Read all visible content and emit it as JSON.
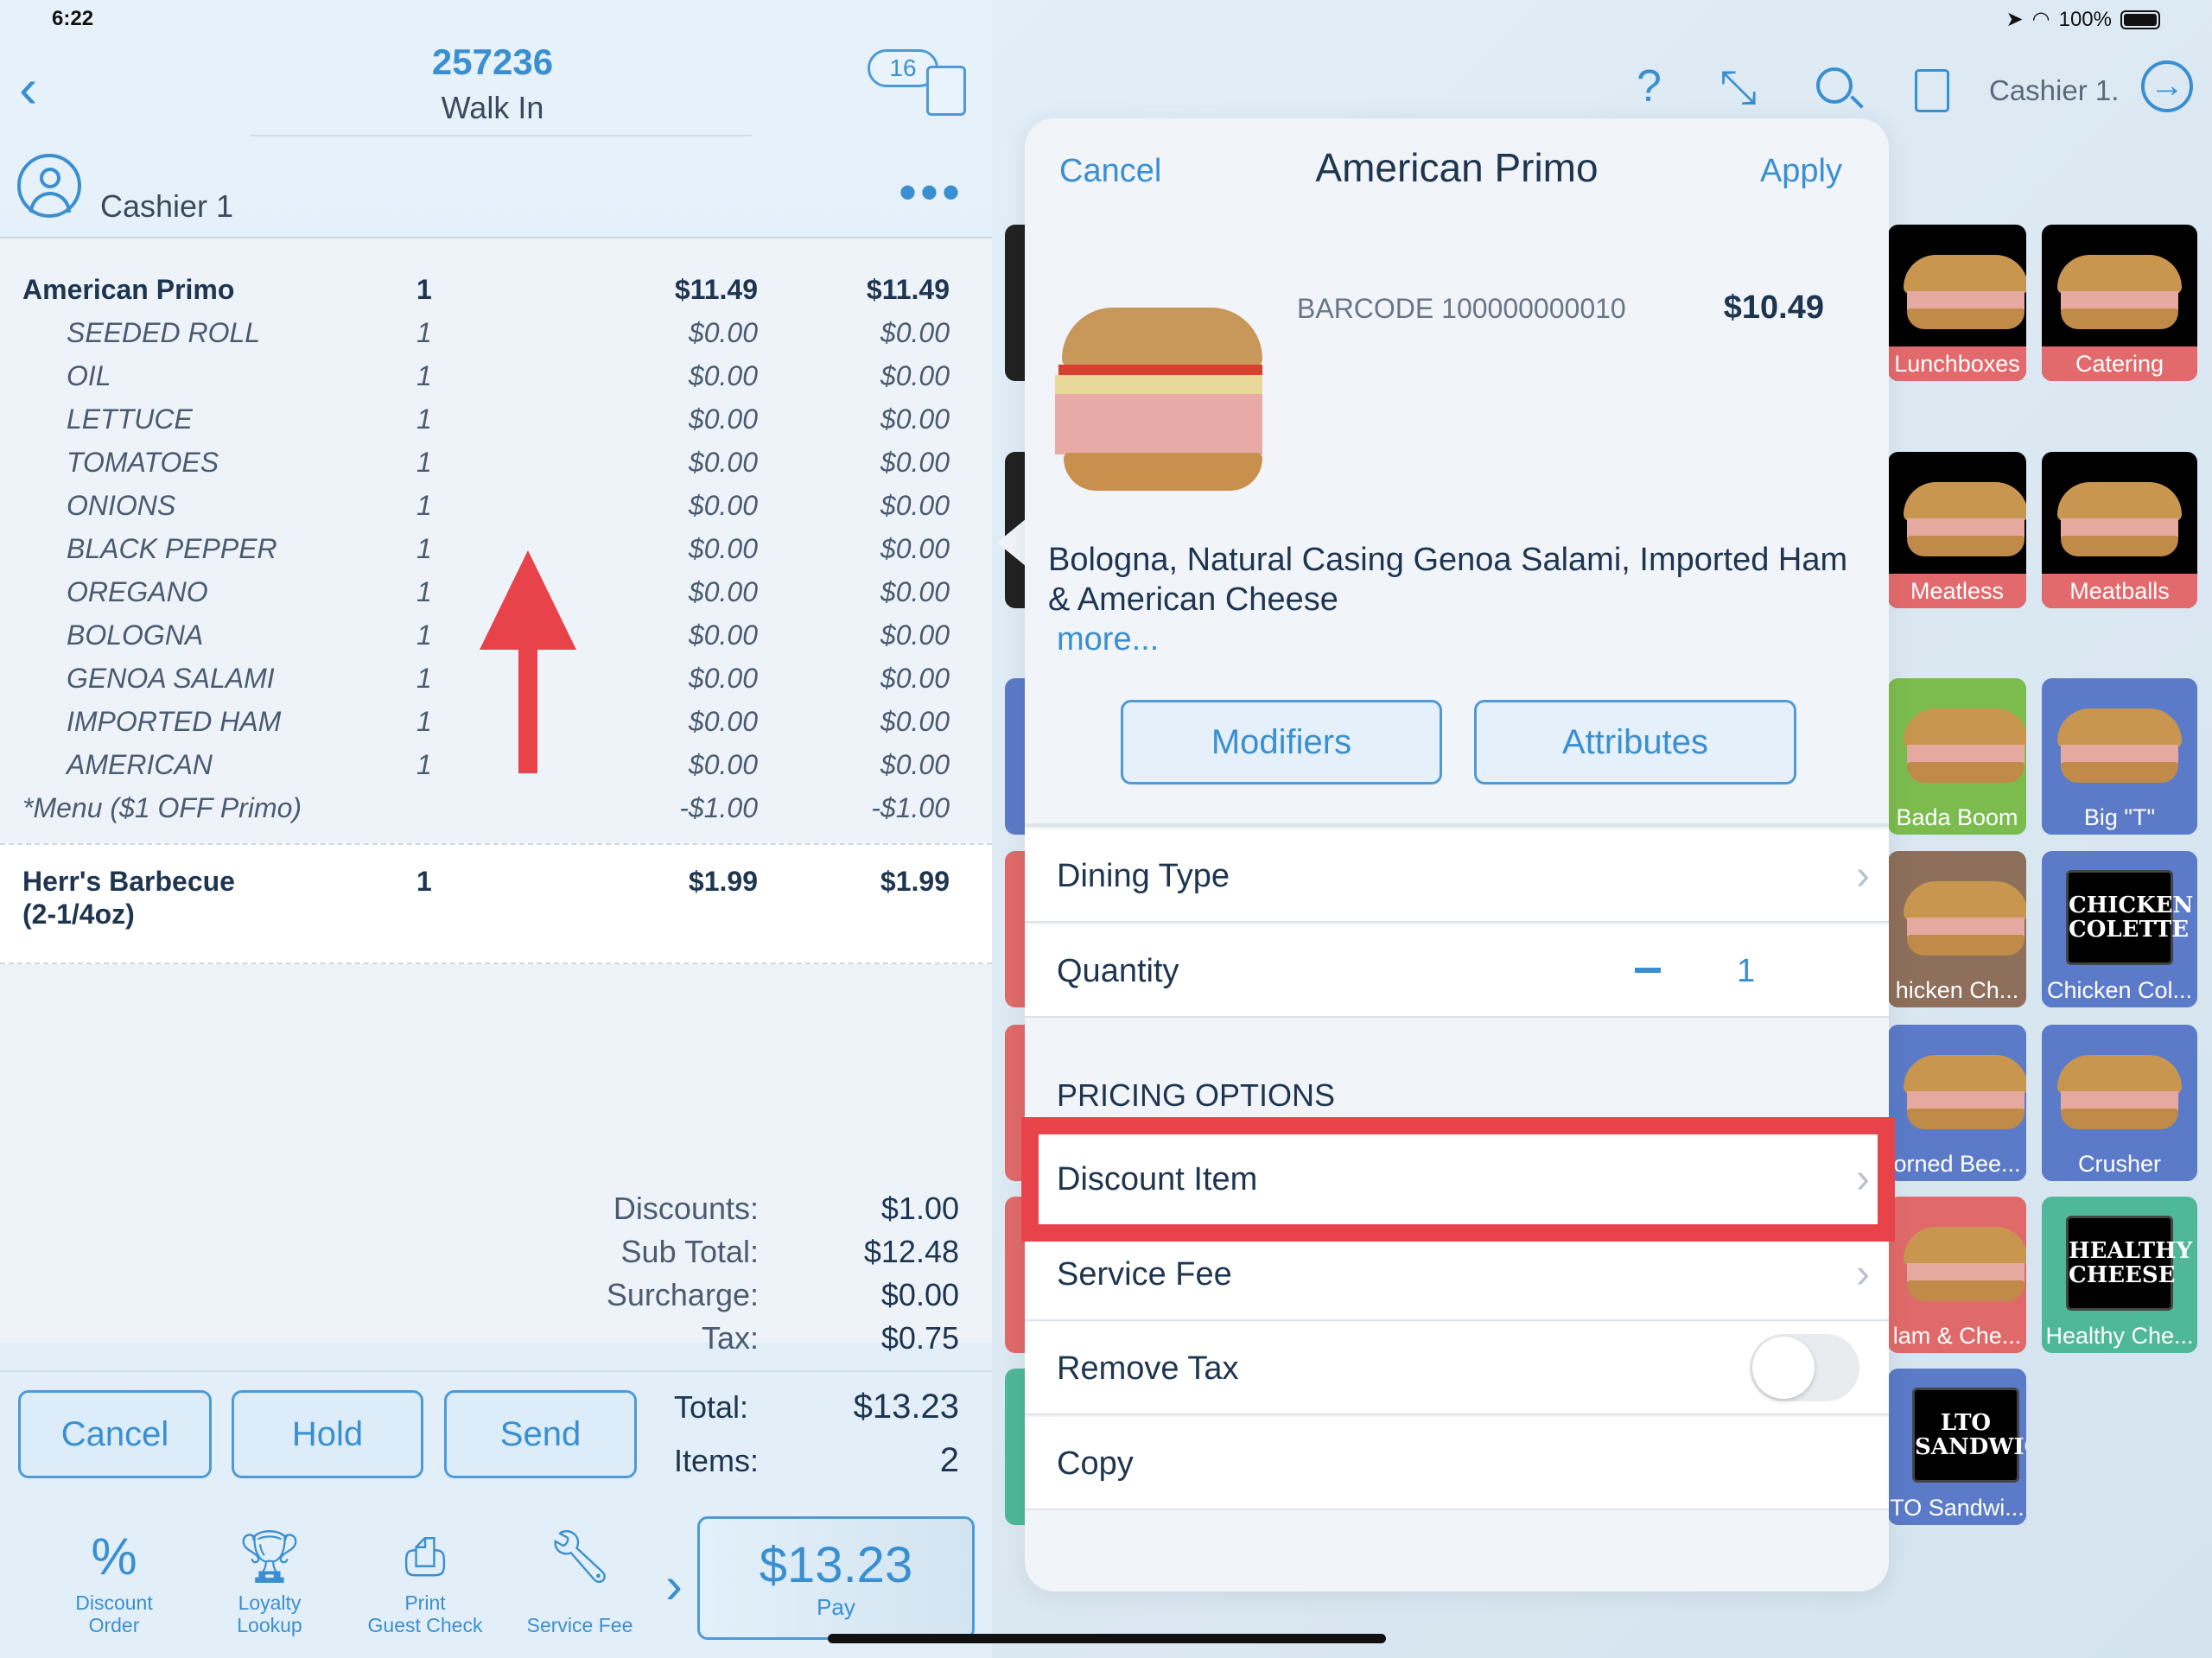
{
  "status": {
    "time": "6:22",
    "battery": "100%"
  },
  "order": {
    "number": "257236",
    "type": "Walk In",
    "badge_count": "16",
    "cashier": "Cashier 1"
  },
  "items": [
    {
      "name": "American Primo",
      "qty": "1",
      "price": "$11.49",
      "total": "$11.49",
      "kind": "main"
    },
    {
      "name": "SEEDED ROLL",
      "qty": "1",
      "price": "$0.00",
      "total": "$0.00",
      "kind": "mod"
    },
    {
      "name": "OIL",
      "qty": "1",
      "price": "$0.00",
      "total": "$0.00",
      "kind": "mod"
    },
    {
      "name": "LETTUCE",
      "qty": "1",
      "price": "$0.00",
      "total": "$0.00",
      "kind": "mod"
    },
    {
      "name": "TOMATOES",
      "qty": "1",
      "price": "$0.00",
      "total": "$0.00",
      "kind": "mod"
    },
    {
      "name": "ONIONS",
      "qty": "1",
      "price": "$0.00",
      "total": "$0.00",
      "kind": "mod"
    },
    {
      "name": "BLACK PEPPER",
      "qty": "1",
      "price": "$0.00",
      "total": "$0.00",
      "kind": "mod"
    },
    {
      "name": "OREGANO",
      "qty": "1",
      "price": "$0.00",
      "total": "$0.00",
      "kind": "mod"
    },
    {
      "name": "BOLOGNA",
      "qty": "1",
      "price": "$0.00",
      "total": "$0.00",
      "kind": "mod"
    },
    {
      "name": "GENOA SALAMI",
      "qty": "1",
      "price": "$0.00",
      "total": "$0.00",
      "kind": "mod"
    },
    {
      "name": "IMPORTED HAM",
      "qty": "1",
      "price": "$0.00",
      "total": "$0.00",
      "kind": "mod"
    },
    {
      "name": "AMERICAN",
      "qty": "1",
      "price": "$0.00",
      "total": "$0.00",
      "kind": "mod"
    },
    {
      "name": "*Menu ($1 OFF Primo)",
      "qty": "",
      "price": "-$1.00",
      "total": "-$1.00",
      "kind": "disc"
    }
  ],
  "item2": {
    "name_line1": "Herr's Barbecue",
    "name_line2": "(2-1/4oz)",
    "qty": "1",
    "price": "$1.99",
    "total": "$1.99"
  },
  "summary": [
    {
      "label": "Discounts:",
      "value": "$1.00"
    },
    {
      "label": "Sub Total:",
      "value": "$12.48"
    },
    {
      "label": "Surcharge:",
      "value": "$0.00"
    },
    {
      "label": "Tax:",
      "value": "$0.75"
    }
  ],
  "actions": {
    "cancel": "Cancel",
    "hold": "Hold",
    "send": "Send",
    "total_label": "Total:",
    "total_value": "$13.23",
    "items_label": "Items:",
    "items_value": "2",
    "pay_amount": "$13.23",
    "pay_label": "Pay"
  },
  "tools": [
    {
      "line1": "Discount",
      "line2": "Order",
      "icon": "percent-icon"
    },
    {
      "line1": "Loyalty",
      "line2": "Lookup",
      "icon": "trophy-icon"
    },
    {
      "line1": "Print",
      "line2": "Guest Check",
      "icon": "printer-icon"
    },
    {
      "line1": "",
      "line2": "Service Fee",
      "icon": "wrench-coins-icon"
    }
  ],
  "topbar": {
    "user": "Cashier 1."
  },
  "modal": {
    "cancel": "Cancel",
    "title": "American Primo",
    "apply": "Apply",
    "barcode": "BARCODE 100000000010",
    "price": "$10.49",
    "desc1": "Bologna, Natural Casing Genoa Salami, Imported Ham",
    "desc2": "& American Cheese",
    "more": "more...",
    "modifiers": "Modifiers",
    "attributes": "Attributes",
    "dining_type": "Dining Type",
    "quantity": "Quantity",
    "quantity_value": "1",
    "pricing_header": "PRICING OPTIONS",
    "discount_item": "Discount Item",
    "service_fee": "Service Fee",
    "remove_tax": "Remove Tax",
    "remove_tax_on": false,
    "copy": "Copy"
  },
  "tiles": [
    {
      "label": "Lunchboxes",
      "color": "#e26a6c",
      "kind": "photo"
    },
    {
      "label": "Catering",
      "color": "#e26a6c",
      "kind": "photo"
    },
    {
      "label": "Meatless",
      "color": "#e26a6c",
      "kind": "photo"
    },
    {
      "label": "Meatballs",
      "color": "#e26a6c",
      "kind": "photo"
    },
    {
      "label": "Bada Boom",
      "color": "#7cbc4f",
      "kind": "bun"
    },
    {
      "label": "Big \"T\"",
      "color": "#5b7bc9",
      "kind": "bun"
    },
    {
      "label": "hicken Ch...",
      "color": "#8d6f5b",
      "kind": "bun"
    },
    {
      "label": "Chicken Col...",
      "color": "#5b7bc9",
      "kind": "logo",
      "logo": "CHICKEN COLETTE"
    },
    {
      "label": "orned Bee...",
      "color": "#5b7bc9",
      "kind": "bun"
    },
    {
      "label": "Crusher",
      "color": "#5b7bc9",
      "kind": "bun"
    },
    {
      "label": "lam & Che...",
      "color": "#e06a6a",
      "kind": "bun"
    },
    {
      "label": "Healthy Che...",
      "color": "#4fb899",
      "kind": "logo",
      "logo": "HEALTHY CHEESE"
    },
    {
      "label": "TO Sandwi...",
      "color": "#5b7bc9",
      "kind": "logo",
      "logo": "LTO SANDWICH"
    }
  ],
  "colors": {
    "accent": "#3a8fd0",
    "highlight": "#e8434a",
    "text": "#1e3550"
  }
}
